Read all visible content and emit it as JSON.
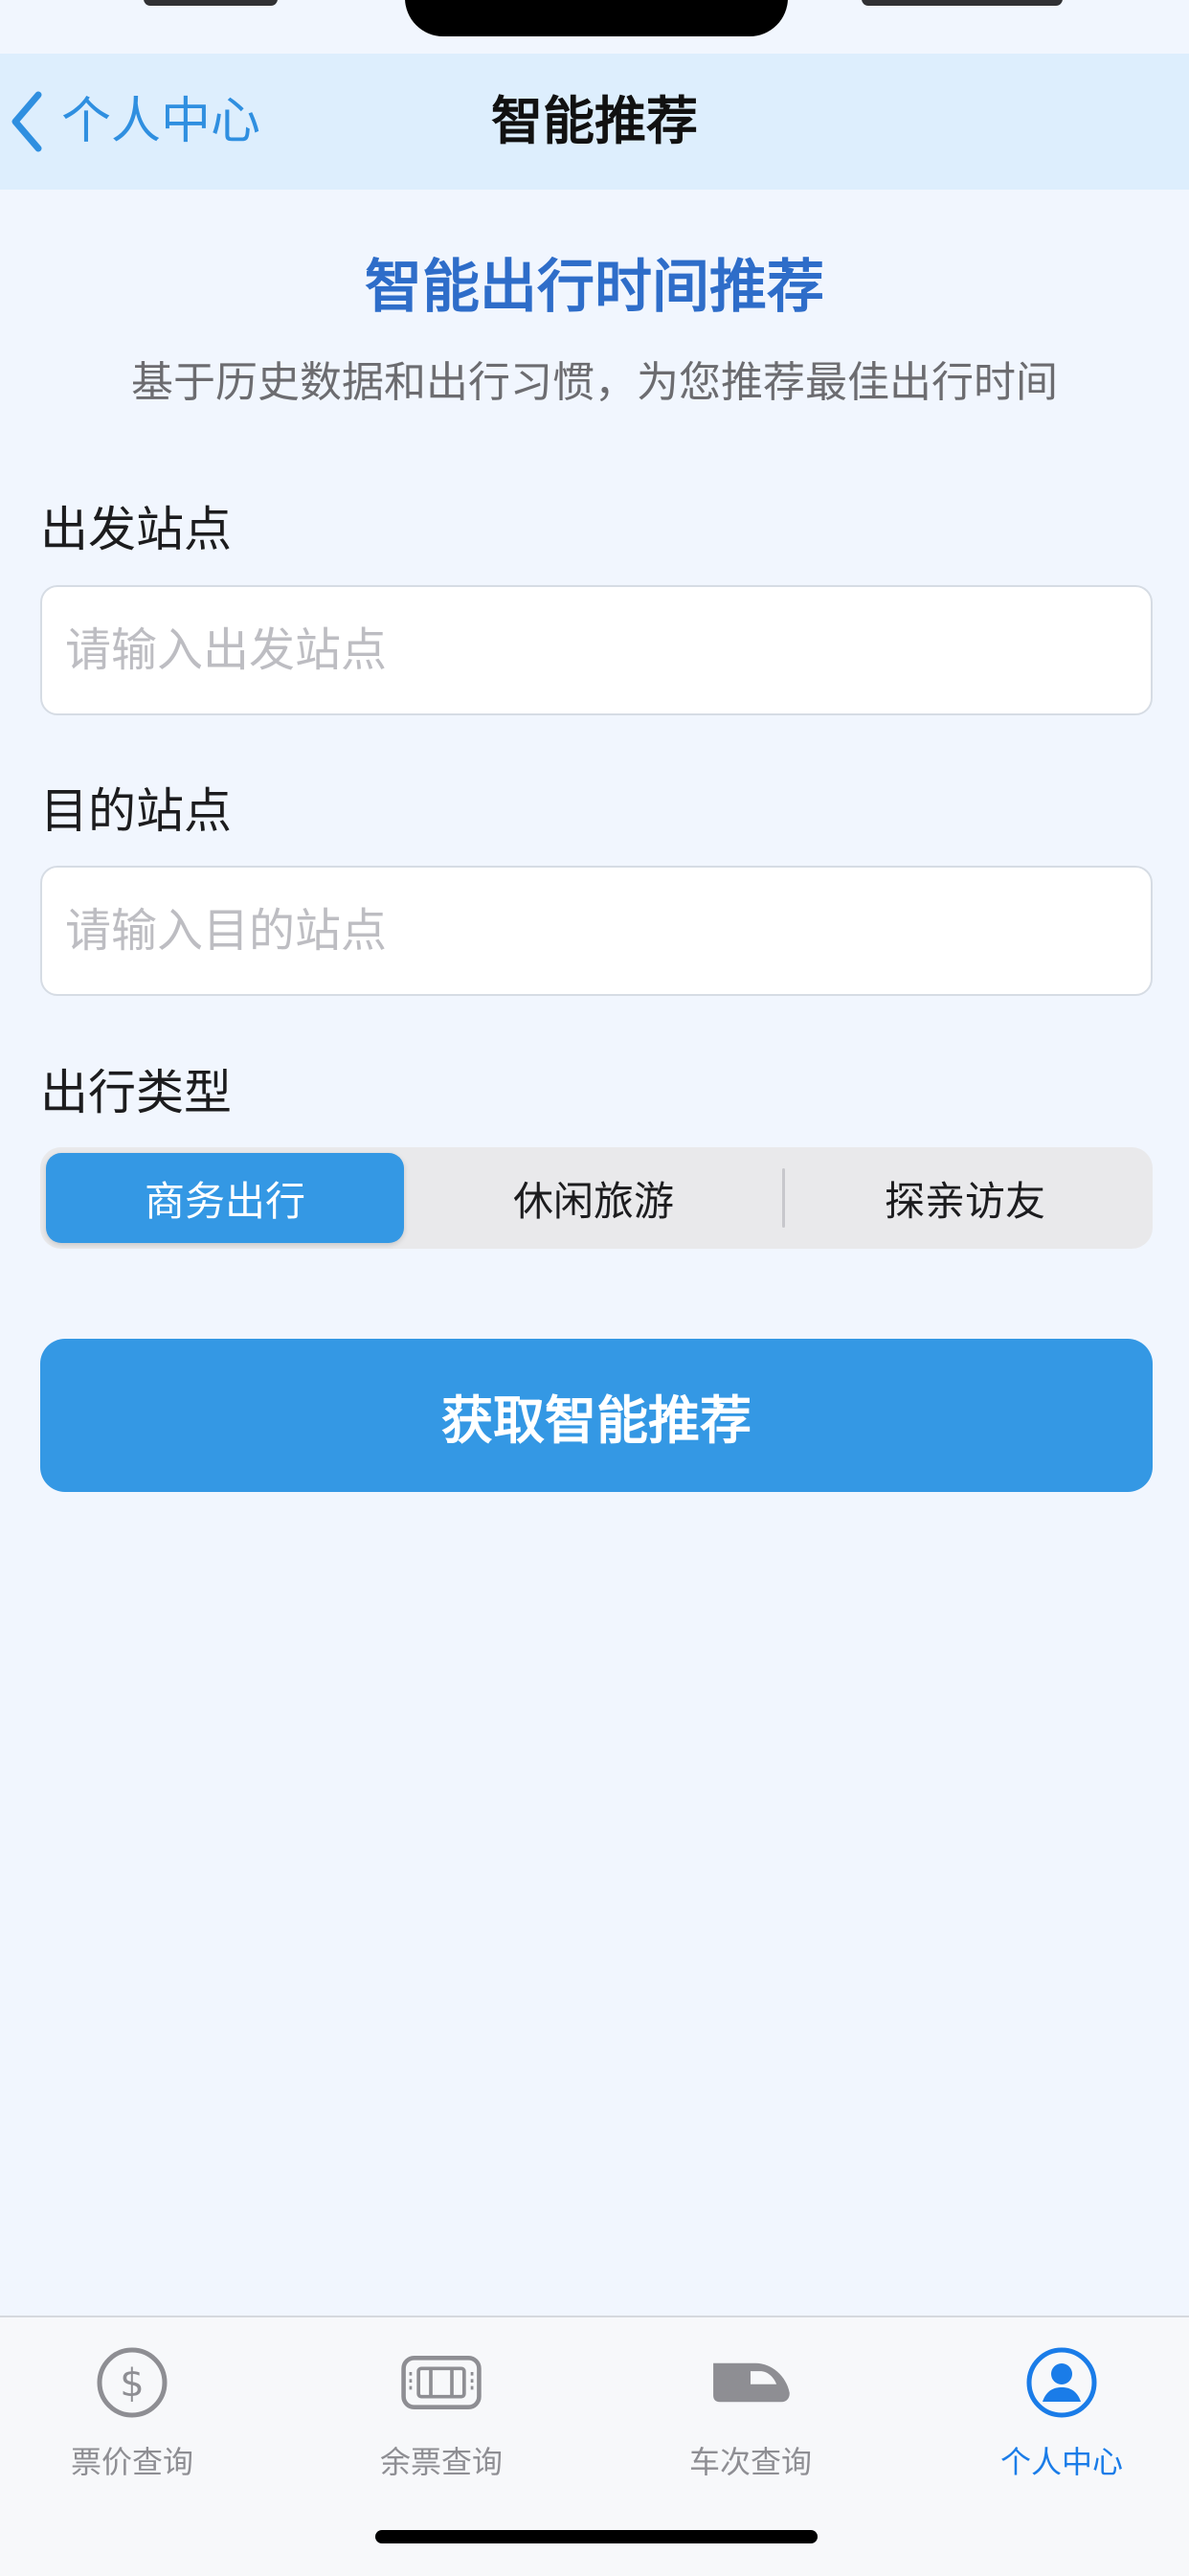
{
  "nav": {
    "back_label": "个人中心",
    "title": "智能推荐"
  },
  "header": {
    "title": "智能出行时间推荐",
    "subtitle": "基于历史数据和出行习惯，为您推荐最佳出行时间"
  },
  "form": {
    "departure": {
      "label": "出发站点",
      "placeholder": "请输入出发站点",
      "value": ""
    },
    "destination": {
      "label": "目的站点",
      "placeholder": "请输入目的站点",
      "value": ""
    },
    "travel_type": {
      "label": "出行类型",
      "options": [
        "商务出行",
        "休闲旅游",
        "探亲访友"
      ],
      "selected": "商务出行"
    },
    "submit_label": "获取智能推荐"
  },
  "tabbar": {
    "items": [
      {
        "label": "票价查询",
        "icon": "dollar-circle-icon",
        "active": false
      },
      {
        "label": "余票查询",
        "icon": "ticket-icon",
        "active": false
      },
      {
        "label": "车次查询",
        "icon": "train-icon",
        "active": false
      },
      {
        "label": "个人中心",
        "icon": "person-circle-icon",
        "active": true
      }
    ]
  },
  "colors": {
    "accent": "#3498E4",
    "heading": "#2E6DC9",
    "nav_background": "#DDEEFD",
    "tab_active": "#1A7CE8",
    "tab_inactive": "#8E8E93"
  }
}
